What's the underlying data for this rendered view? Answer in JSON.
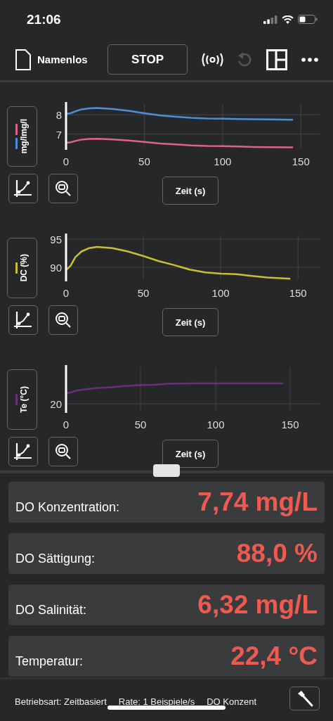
{
  "status_bar": {
    "time": "21:06"
  },
  "toolbar": {
    "document": "Namenlos",
    "stop": "STOP",
    "undo": {
      "disabled": true
    }
  },
  "charts": [
    {
      "chart_data": {
        "type": "line",
        "ylabel": "mg/lmg/l",
        "xlabel": "Zeit (s)",
        "x": [
          0,
          3,
          6,
          10,
          15,
          20,
          30,
          40,
          50,
          60,
          70,
          80,
          90,
          100,
          110,
          120,
          130,
          145
        ],
        "xlim": [
          0,
          162
        ],
        "ylim": [
          6.3,
          8.55
        ],
        "xticks": [
          0,
          50,
          100,
          150
        ],
        "yticks": [
          7,
          8
        ],
        "grid": true,
        "series": [
          {
            "color": "#4a8fd8",
            "values": [
              8.05,
              8.08,
              8.18,
              8.28,
              8.33,
              8.35,
              8.3,
              8.2,
              8.08,
              7.97,
              7.9,
              7.84,
              7.81,
              7.8,
              7.78,
              7.77,
              7.76,
              7.74
            ]
          },
          {
            "color": "#e0608e",
            "values": [
              6.55,
              6.58,
              6.65,
              6.72,
              6.75,
              6.76,
              6.73,
              6.67,
              6.6,
              6.52,
              6.47,
              6.42,
              6.39,
              6.38,
              6.36,
              6.34,
              6.33,
              6.32
            ]
          }
        ]
      }
    },
    {
      "chart_data": {
        "type": "line",
        "ylabel": "DC (%)",
        "xlabel": "Zeit (s)",
        "x": [
          0,
          3,
          6,
          10,
          15,
          20,
          30,
          40,
          50,
          60,
          70,
          80,
          90,
          100,
          110,
          120,
          130,
          145
        ],
        "xlim": [
          0,
          164
        ],
        "ylim": [
          87.9,
          95.6
        ],
        "xticks": [
          0,
          50,
          100,
          150
        ],
        "yticks": [
          90,
          95
        ],
        "grid": true,
        "series": [
          {
            "color": "#c8c034",
            "values": [
              89.5,
              90.3,
              91.8,
              92.8,
              93.4,
              93.6,
              93.4,
              92.8,
              92.0,
              91.1,
              90.4,
              89.6,
              89.1,
              88.9,
              88.8,
              88.5,
              88.2,
              88.0
            ]
          }
        ]
      }
    },
    {
      "ylabel": "Te (°C)",
      "xlabel": "Zeit (s)",
      "x_labels": [
        "0",
        "50",
        "100",
        "150"
      ],
      "y_labels": [
        "20"
      ],
      "series": [
        {
          "color": "#6a2f78"
        }
      ]
    }
  ],
  "readings": [
    {
      "label": "DO Konzentration:",
      "value": "7,74 mg/L"
    },
    {
      "label": "DO Sättigung:",
      "value": "88,0 %"
    },
    {
      "label": "DO Salinität:",
      "value": "6,32 mg/L"
    },
    {
      "label": "Temperatur:",
      "value": "22,4 °C"
    }
  ],
  "footer": {
    "items": [
      "Betriebsart: Zeitbasiert",
      "Rate: 1 Beispiele/s",
      "DO Konzent"
    ]
  }
}
